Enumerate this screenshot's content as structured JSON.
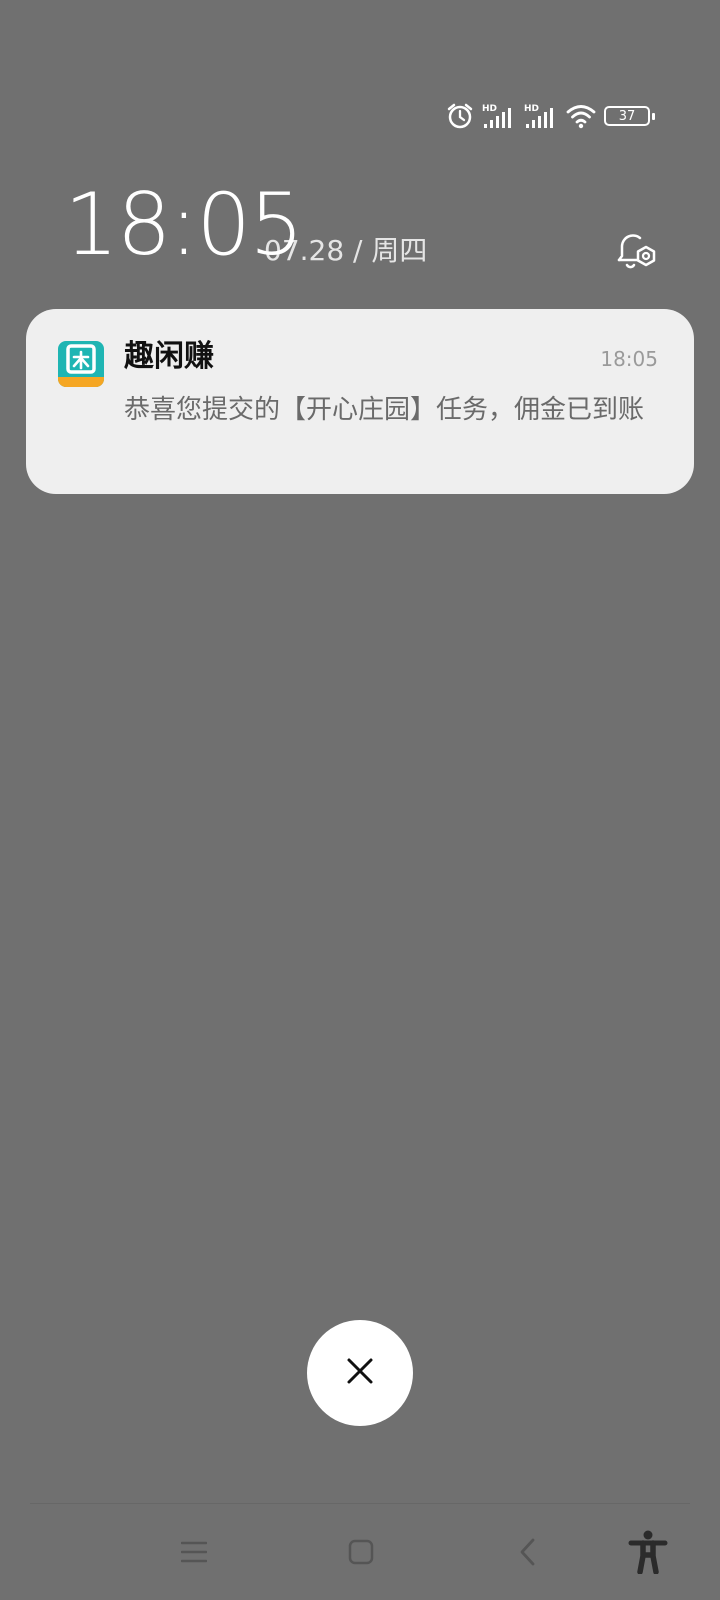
{
  "status_bar": {
    "icons": [
      "alarm-icon",
      "signal-hd-icon",
      "signal-hd-icon",
      "wifi-icon",
      "battery-icon"
    ],
    "hd_label_1": "HD",
    "hd_label_2": "HD",
    "battery_level": "37"
  },
  "lockscreen": {
    "time": "18:05",
    "date": "07.28 / 周四"
  },
  "notification": {
    "app_name": "趣闲赚",
    "time": "18:05",
    "body": "恭喜您提交的【开心庄园】任务，佣金已到账",
    "icon_colors": {
      "background": "#1fb5b3",
      "band": "#f5a623"
    }
  },
  "navigation": {
    "icons": [
      "menu-icon",
      "home-icon",
      "back-icon",
      "accessibility-icon"
    ]
  },
  "colors": {
    "background": "#707070",
    "card": "#efefef"
  }
}
